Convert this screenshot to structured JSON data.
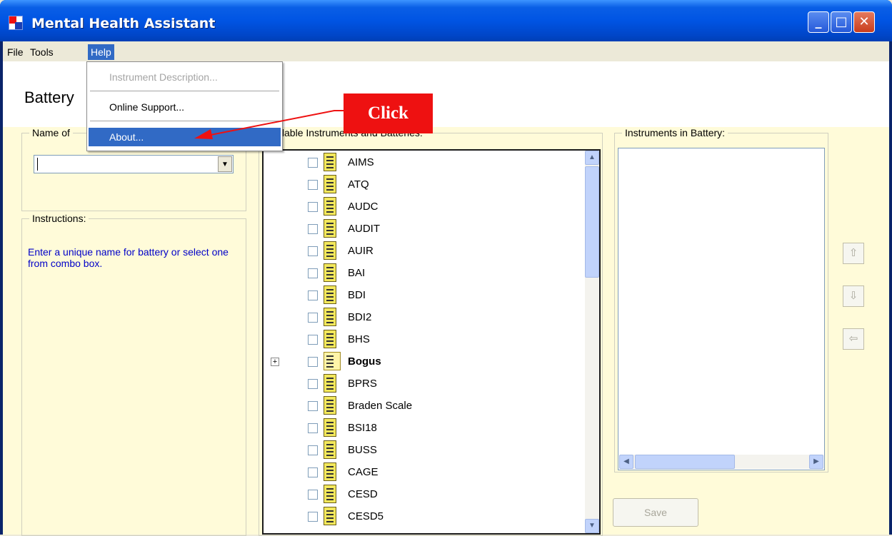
{
  "window": {
    "title": "Mental Health Assistant",
    "minimize_glyph": "_",
    "maximize_glyph": "□",
    "close_glyph": "✕"
  },
  "menubar": {
    "file": "File",
    "tools": "Tools",
    "help": "Help"
  },
  "help_menu": {
    "items": [
      {
        "label": "Instrument Description...",
        "enabled": false
      },
      {
        "label": "Online Support...",
        "enabled": true
      },
      {
        "label": "About...",
        "enabled": true,
        "highlighted": true
      }
    ]
  },
  "page": {
    "title": "Battery"
  },
  "name_group": {
    "legend": "Name of",
    "combo_value": "",
    "combo_arrow": "▼"
  },
  "instructions_group": {
    "legend": "Instructions:",
    "text": "Enter a unique name for battery or select one from combo box."
  },
  "available_group": {
    "legend": "vailable Instruments and Batteries:",
    "items": [
      {
        "label": "AIMS",
        "bold": false
      },
      {
        "label": "ATQ",
        "bold": false
      },
      {
        "label": "AUDC",
        "bold": false
      },
      {
        "label": "AUDIT",
        "bold": false
      },
      {
        "label": "AUIR",
        "bold": false
      },
      {
        "label": "BAI",
        "bold": false
      },
      {
        "label": "BDI",
        "bold": false
      },
      {
        "label": "BDI2",
        "bold": false
      },
      {
        "label": "BHS",
        "bold": false
      },
      {
        "label": "Bogus",
        "bold": true,
        "expandable": true
      },
      {
        "label": "BPRS",
        "bold": false
      },
      {
        "label": "Braden Scale",
        "bold": false
      },
      {
        "label": "BSI18",
        "bold": false
      },
      {
        "label": "BUSS",
        "bold": false
      },
      {
        "label": "CAGE",
        "bold": false
      },
      {
        "label": "CESD",
        "bold": false
      },
      {
        "label": "CESD5",
        "bold": false
      }
    ],
    "expander_glyph": "+",
    "scroll_up": "▲",
    "scroll_down": "▼"
  },
  "battery_group": {
    "legend": "Instruments in Battery:",
    "scroll_left": "◀",
    "scroll_right": "▶"
  },
  "side_buttons": {
    "up": "⇧",
    "down": "⇩",
    "left": "⇦"
  },
  "save_button": {
    "label": "Save"
  },
  "annotation": {
    "label": "Click",
    "color": "#EE1111"
  }
}
